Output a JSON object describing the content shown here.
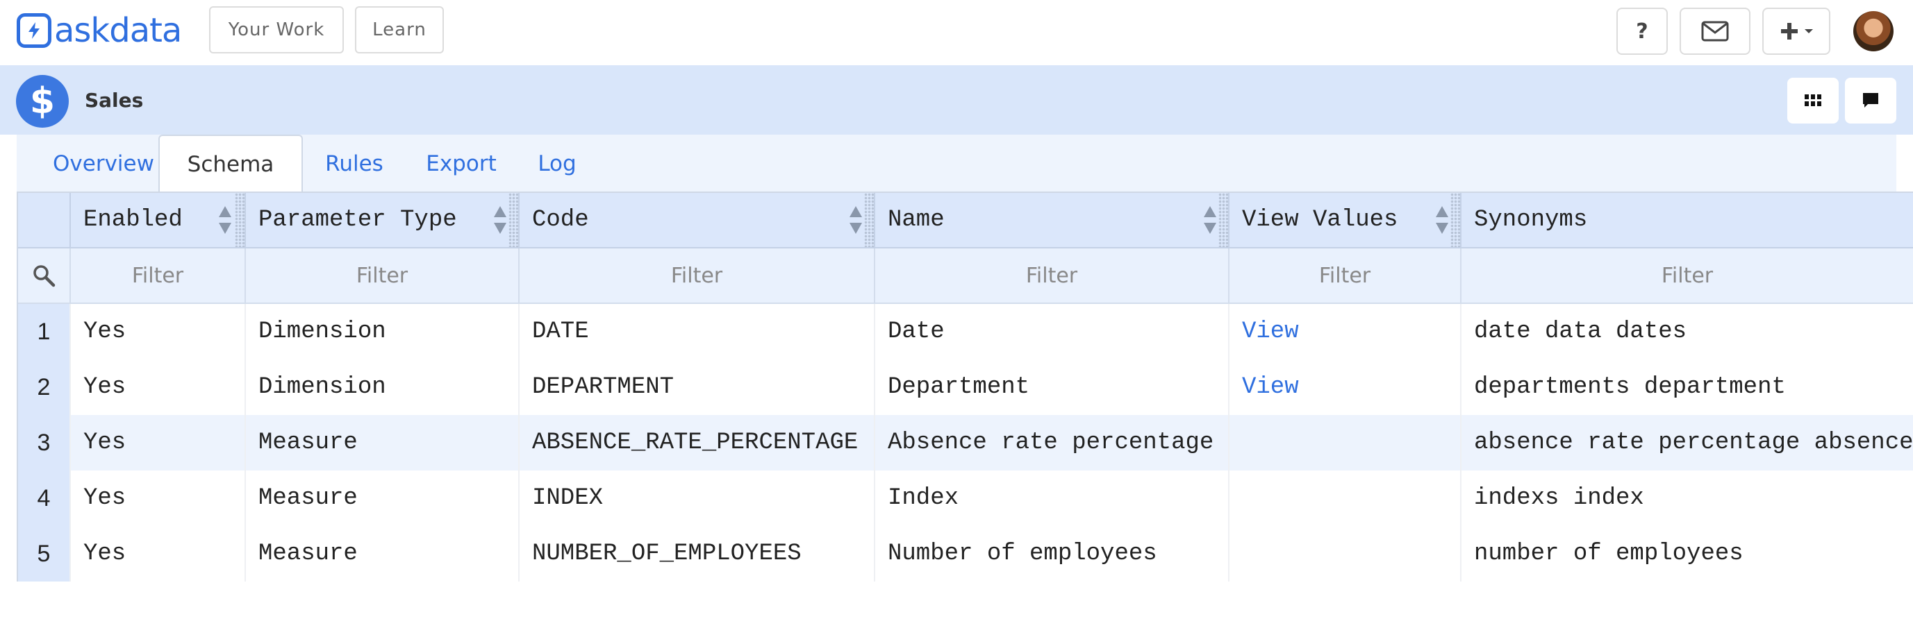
{
  "app": {
    "logo_text": "askdata",
    "nav": {
      "your_work": "Your Work",
      "learn": "Learn"
    },
    "icons": [
      "help-icon",
      "mail-icon",
      "plus-icon",
      "chevron-down-icon",
      "avatar"
    ]
  },
  "dataset": {
    "title": "Sales",
    "badge_symbol": "$",
    "actions": [
      "grid-icon",
      "chat-icon"
    ]
  },
  "tabs": [
    {
      "label": "Overview",
      "active": false
    },
    {
      "label": "Schema",
      "active": true
    },
    {
      "label": "Rules",
      "active": false
    },
    {
      "label": "Export",
      "active": false
    },
    {
      "label": "Log",
      "active": false
    }
  ],
  "table": {
    "columns": [
      "Enabled",
      "Parameter Type",
      "Code",
      "Name",
      "View Values",
      "Synonyms"
    ],
    "filter_placeholder": "Filter",
    "rows": [
      {
        "num": "1",
        "enabled": "Yes",
        "type": "Dimension",
        "code": "DATE",
        "name": "Date",
        "view": "View",
        "synonyms": "date data dates"
      },
      {
        "num": "2",
        "enabled": "Yes",
        "type": "Dimension",
        "code": "DEPARTMENT",
        "name": "Department",
        "view": "View",
        "synonyms": "departments department"
      },
      {
        "num": "3",
        "enabled": "Yes",
        "type": "Measure",
        "code": "ABSENCE_RATE_PERCENTAGE",
        "name": "Absence rate percentage",
        "view": "",
        "synonyms": "absence rate percentage absence"
      },
      {
        "num": "4",
        "enabled": "Yes",
        "type": "Measure",
        "code": "INDEX",
        "name": "Index",
        "view": "",
        "synonyms": "indexs index"
      },
      {
        "num": "5",
        "enabled": "Yes",
        "type": "Measure",
        "code": "NUMBER_OF_EMPLOYEES",
        "name": "Number of employees",
        "view": "",
        "synonyms": "number of employees"
      }
    ]
  },
  "colors": {
    "accent": "#2f6fdf",
    "header_band": "#d9e6fa",
    "grid_header": "#dbe7fb"
  }
}
